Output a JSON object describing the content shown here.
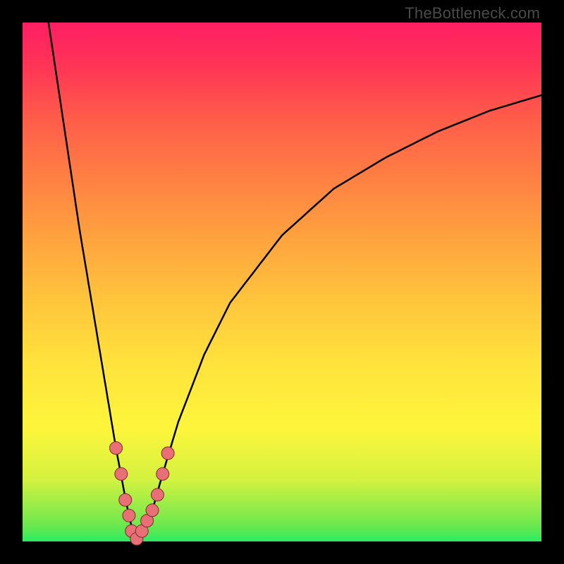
{
  "watermark": "TheBottleneck.com",
  "colors": {
    "frame": "#000000",
    "curve_stroke": "#000000",
    "marker_fill": "#e86f75",
    "marker_stroke": "#7a2b30"
  },
  "chart_data": {
    "type": "line",
    "title": "",
    "xlabel": "",
    "ylabel": "",
    "xlim": [
      0,
      100
    ],
    "ylim": [
      0,
      100
    ],
    "grid": false,
    "notes": "Gradient background encodes y-value (green≈good near 0, red≈bad near 100). Single black curve dips to ~0 near x≈22 then rises toward ~85 at x=100. Pink round markers cluster around the valley.",
    "series": [
      {
        "name": "bottleneck-curve",
        "x": [
          5,
          8,
          11,
          14,
          16,
          18,
          19.5,
          20.5,
          21.5,
          22.5,
          23.5,
          25,
          27,
          30,
          35,
          40,
          50,
          60,
          70,
          80,
          90,
          100
        ],
        "y": [
          100,
          80,
          60,
          42,
          30,
          18,
          10,
          5,
          1,
          0.5,
          2,
          6,
          13,
          23,
          36,
          46,
          59,
          68,
          74,
          79,
          83,
          86
        ]
      }
    ],
    "markers": {
      "name": "highlight-points",
      "x": [
        18,
        19,
        19.8,
        20.5,
        21,
        22,
        23,
        24,
        25,
        26,
        27,
        28
      ],
      "y": [
        18,
        13,
        8,
        5,
        2,
        0.5,
        2,
        4,
        6,
        9,
        13,
        17
      ]
    }
  }
}
